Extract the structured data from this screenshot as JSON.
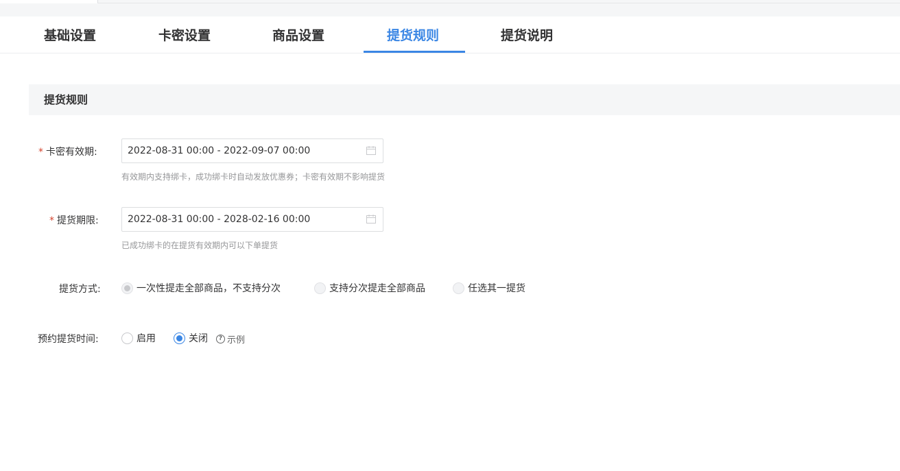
{
  "tabs": [
    {
      "label": "基础设置"
    },
    {
      "label": "卡密设置"
    },
    {
      "label": "商品设置"
    },
    {
      "label": "提货规则"
    },
    {
      "label": "提货说明"
    }
  ],
  "active_tab": "提货规则",
  "accent_color": "#3a86e4",
  "required_color": "#d4442e",
  "section": {
    "title": "提货规则"
  },
  "form": {
    "required_mark": "*",
    "card_validity": {
      "label": "卡密有效期:",
      "value": "2022-08-31 00:00 - 2022-09-07 00:00",
      "help": "有效期内支持绑卡，成功绑卡时自动发放优惠券；卡密有效期不影响提货",
      "icon": "calendar-icon"
    },
    "pickup_period": {
      "label": "提货期限:",
      "value": "2022-08-31 00:00 - 2028-02-16 00:00",
      "help": "已成功绑卡的在提货有效期内可以下单提货",
      "icon": "calendar-icon"
    },
    "pickup_method": {
      "label": "提货方式:",
      "options": [
        {
          "label": "一次性提走全部商品，不支持分次",
          "checked": true,
          "disabled": true
        },
        {
          "label": "支持分次提走全部商品",
          "checked": false,
          "disabled": true
        },
        {
          "label": "任选其一提货",
          "checked": false,
          "disabled": true
        }
      ]
    },
    "reserve_time": {
      "label": "预约提货时间:",
      "options": [
        {
          "label": "启用",
          "checked": false
        },
        {
          "label": "关闭",
          "checked": true
        }
      ],
      "example_label": "示例",
      "example_icon": "question-circle-icon"
    }
  }
}
